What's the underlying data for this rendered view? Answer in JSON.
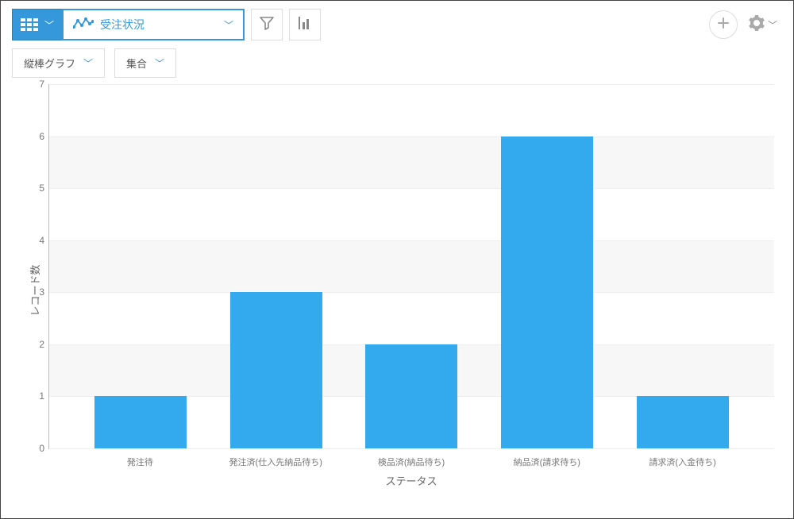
{
  "toolbar": {
    "selected_view": "受注状況"
  },
  "controls": {
    "chart_type": "縦棒グラフ",
    "group_mode": "集合"
  },
  "chart_data": {
    "type": "bar",
    "categories": [
      "発注待",
      "発注済(仕入先納品待ち)",
      "検品済(納品待ち)",
      "納品済(請求待ち)",
      "請求済(入金待ち)"
    ],
    "values": [
      1,
      3,
      2,
      6,
      1
    ],
    "xlabel": "ステータス",
    "ylabel": "レコード数",
    "ylim": [
      0,
      7
    ],
    "yticks": [
      0,
      1,
      2,
      3,
      4,
      5,
      6,
      7
    ],
    "bar_color": "#33aaee"
  }
}
